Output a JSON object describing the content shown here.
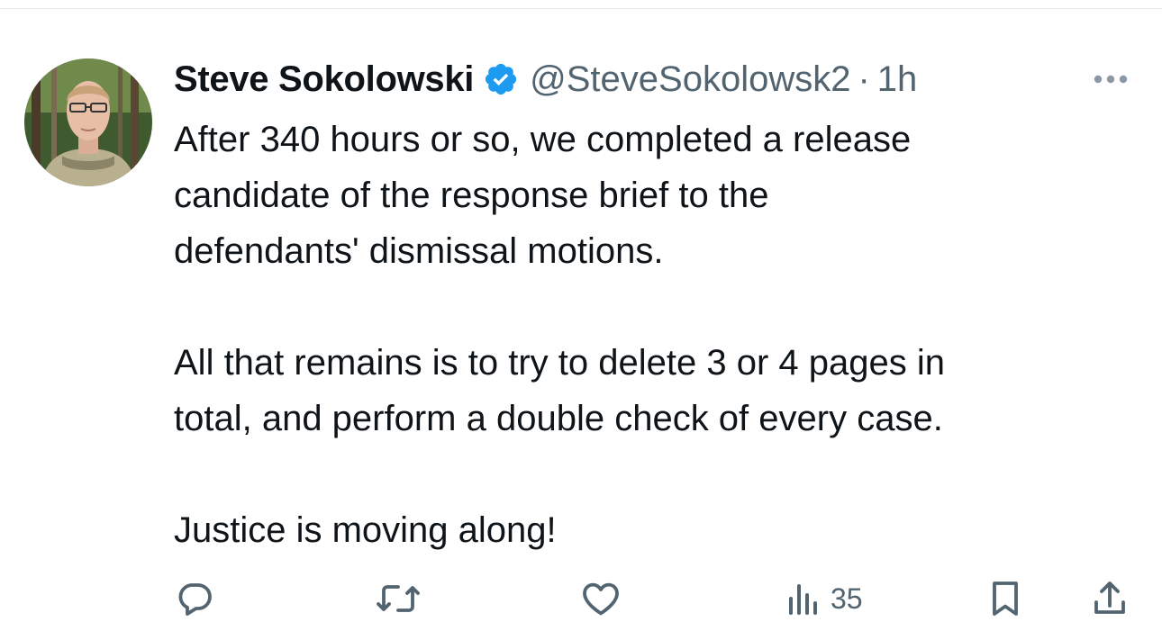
{
  "tweet": {
    "author_name": "Steve Sokolowski",
    "handle": "@SteveSokolowsk2",
    "separator": "·",
    "timestamp": "1h",
    "verified": true,
    "text_lines": [
      "After 340 hours or so, we completed a release",
      "candidate of the response brief to the",
      "defendants' dismissal motions.",
      "All that remains is to try to delete 3 or 4 pages in",
      "total, and perform a double check of every case.",
      "Justice is moving along!"
    ]
  },
  "actions": {
    "views_count": "35"
  },
  "colors": {
    "text": "#0f1419",
    "secondary": "#536471",
    "verified_badge": "#1d9bf0",
    "divider": "#e7e9ea"
  },
  "icons": {
    "more": "more-horizontal-icon",
    "reply": "reply-icon",
    "retweet": "retweet-icon",
    "like": "like-icon",
    "views": "views-icon",
    "bookmark": "bookmark-icon",
    "share": "share-icon"
  }
}
